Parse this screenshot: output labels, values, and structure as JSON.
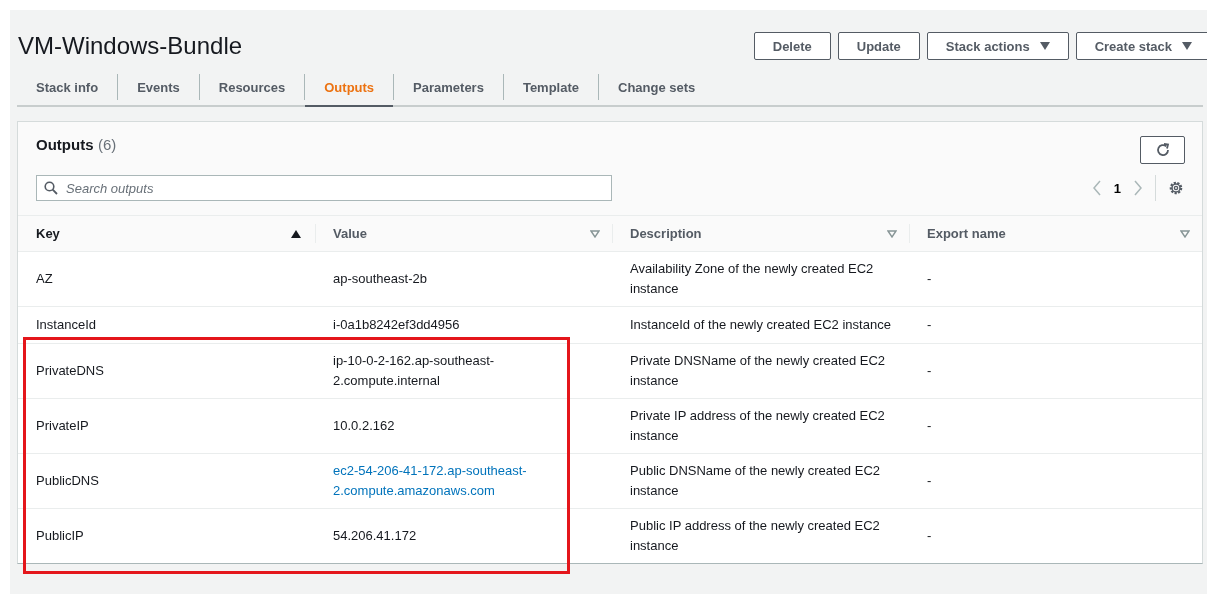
{
  "title": "VM-Windows-Bundle",
  "actions": [
    {
      "label": "Delete",
      "dropdown": false
    },
    {
      "label": "Update",
      "dropdown": false
    },
    {
      "label": "Stack actions",
      "dropdown": true
    },
    {
      "label": "Create stack",
      "dropdown": true
    }
  ],
  "tabs": [
    {
      "label": "Stack info",
      "selected": false
    },
    {
      "label": "Events",
      "selected": false
    },
    {
      "label": "Resources",
      "selected": false
    },
    {
      "label": "Outputs",
      "selected": true
    },
    {
      "label": "Parameters",
      "selected": false
    },
    {
      "label": "Template",
      "selected": false
    },
    {
      "label": "Change sets",
      "selected": false
    }
  ],
  "panel": {
    "title": "Outputs",
    "count": "(6)",
    "search": {
      "placeholder": "Search outputs"
    },
    "page": "1"
  },
  "table": {
    "columns": [
      {
        "label": "Key",
        "sorted": true
      },
      {
        "label": "Value",
        "sorted": false
      },
      {
        "label": "Description",
        "sorted": false
      },
      {
        "label": "Export name",
        "sorted": false
      }
    ],
    "rows": [
      {
        "key": "AZ",
        "value": "ap-southeast-2b",
        "link": false,
        "description": "Availability Zone of the newly created EC2 instance",
        "export": "-",
        "highlighted": false
      },
      {
        "key": "InstanceId",
        "value": "i-0a1b8242ef3dd4956",
        "link": false,
        "description": "InstanceId of the newly created EC2 instance",
        "export": "-",
        "highlighted": false
      },
      {
        "key": "PrivateDNS",
        "value": "ip-10-0-2-162.ap-southeast-2.compute.internal",
        "link": false,
        "description": "Private DNSName of the newly created EC2 instance",
        "export": "-",
        "highlighted": true
      },
      {
        "key": "PrivateIP",
        "value": "10.0.2.162",
        "link": false,
        "description": "Private IP address of the newly created EC2 instance",
        "export": "-",
        "highlighted": true
      },
      {
        "key": "PublicDNS",
        "value": "ec2-54-206-41-172.ap-southeast-2.compute.amazonaws.com",
        "link": true,
        "description": "Public DNSName of the newly created EC2 instance",
        "export": "-",
        "highlighted": true
      },
      {
        "key": "PublicIP",
        "value": "54.206.41.172",
        "link": false,
        "description": "Public IP address of the newly created EC2 instance",
        "export": "-",
        "highlighted": true
      }
    ]
  }
}
